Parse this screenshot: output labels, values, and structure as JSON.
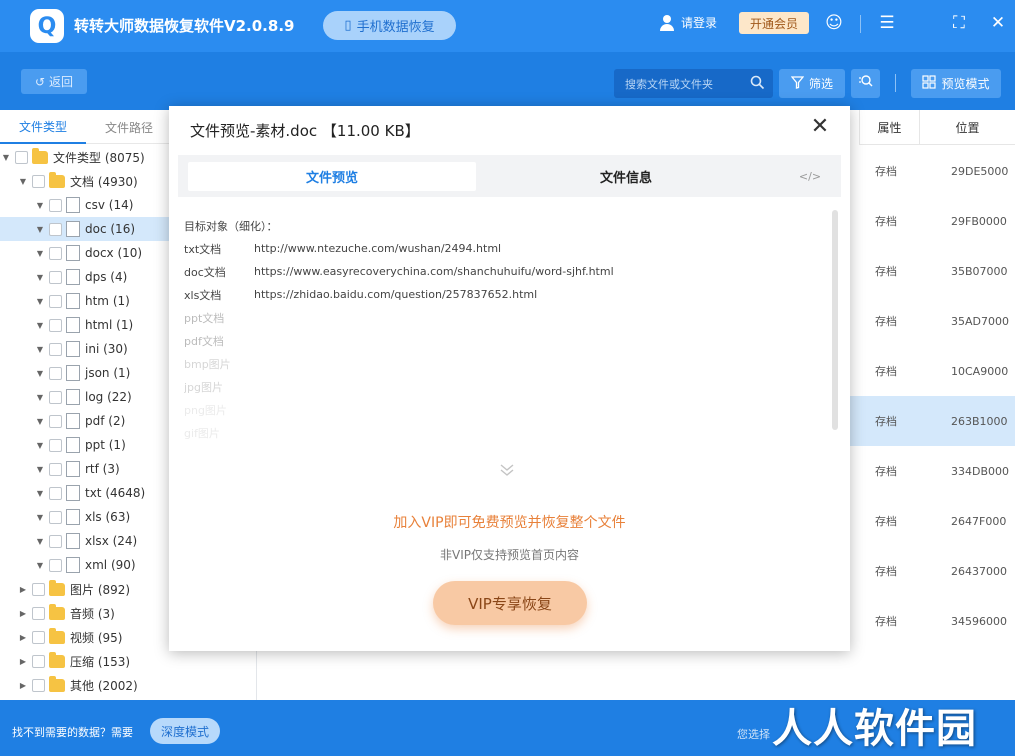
{
  "window": {
    "title": "转转大师数据恢复软件V2.0.8.9",
    "logo_icon": "app-logo-icon",
    "mobile_recovery": "手机数据恢复",
    "login": "请登录",
    "vip": "开通会员",
    "accent": "#2b8cf0"
  },
  "toolbar": {
    "back": "返回",
    "search_placeholder": "搜索文件或文件夹",
    "filter": "筛选",
    "preview_mode": "预览模式"
  },
  "sidebar": {
    "tabs": [
      "文件类型",
      "文件路径"
    ],
    "root": "文件类型 (8075)",
    "docs": "文档 (4930)",
    "doc_items": [
      {
        "label": "csv (14)",
        "icon": "csv-file-icon"
      },
      {
        "label": "doc (16)",
        "icon": "doc-file-icon"
      },
      {
        "label": "docx (10)",
        "icon": "docx-file-icon"
      },
      {
        "label": "dps (4)",
        "icon": "dps-file-icon"
      },
      {
        "label": "htm (1)",
        "icon": "htm-file-icon"
      },
      {
        "label": "html (1)",
        "icon": "html-file-icon"
      },
      {
        "label": "ini (30)",
        "icon": "ini-file-icon"
      },
      {
        "label": "json (1)",
        "icon": "json-file-icon"
      },
      {
        "label": "log (22)",
        "icon": "log-file-icon"
      },
      {
        "label": "pdf (2)",
        "icon": "pdf-file-icon"
      },
      {
        "label": "ppt (1)",
        "icon": "ppt-file-icon"
      },
      {
        "label": "rtf (3)",
        "icon": "rtf-file-icon"
      },
      {
        "label": "txt (4648)",
        "icon": "txt-file-icon"
      },
      {
        "label": "xls (63)",
        "icon": "xls-file-icon"
      },
      {
        "label": "xlsx (24)",
        "icon": "xlsx-file-icon"
      },
      {
        "label": "xml (90)",
        "icon": "xml-file-icon"
      }
    ],
    "folders": [
      "图片 (892)",
      "音频 (3)",
      "视频 (95)",
      "压缩 (153)",
      "其他 (2002)"
    ]
  },
  "table": {
    "headers": {
      "attr": "属性",
      "pos": "位置"
    },
    "rows": [
      {
        "attr": "存档",
        "pos": "29DE5000"
      },
      {
        "attr": "存档",
        "pos": "29FB0000"
      },
      {
        "attr": "存档",
        "pos": "35B07000"
      },
      {
        "attr": "存档",
        "pos": "35AD7000"
      },
      {
        "attr": "存档",
        "pos": "10CA9000"
      },
      {
        "attr": "存档",
        "pos": "263B1000"
      },
      {
        "attr": "存档",
        "pos": "334DB000"
      },
      {
        "attr": "存档",
        "pos": "2647F000"
      },
      {
        "attr": "存档",
        "pos": "26437000"
      },
      {
        "attr": "存档",
        "pos": "34596000"
      }
    ]
  },
  "modal": {
    "title": "文件预览-素材.doc 【11.00 KB】",
    "tabs": {
      "preview": "文件预览",
      "info": "文件信息",
      "code": "</>"
    },
    "preview_header": "目标对象（细化）：",
    "lines": [
      {
        "k": "txt文档",
        "v": "http://www.ntezuche.com/wushan/2494.html"
      },
      {
        "k": "doc文档",
        "v": "https://www.easyrecoverychina.com/shanchuhuifu/word-sjhf.html"
      },
      {
        "k": "xls文档",
        "v": "https://zhidao.baidu.com/question/257837652.html"
      },
      {
        "k": "ppt文档",
        "v": ""
      },
      {
        "k": "pdf文档",
        "v": ""
      },
      {
        "k": "bmp图片",
        "v": ""
      },
      {
        "k": "jpg图片",
        "v": ""
      },
      {
        "k": "png图片",
        "v": ""
      },
      {
        "k": "gif图片",
        "v": ""
      }
    ],
    "vip_message": "加入VIP即可免费预览并恢复整个文件",
    "nonvip_message": "非VIP仅支持预览首页内容",
    "vip_button": "VIP专享恢复"
  },
  "bottom": {
    "hint": "找不到需要的数据？需要",
    "deep_mode": "深度模式",
    "selected": "您选择"
  },
  "watermark": "人人软件园"
}
